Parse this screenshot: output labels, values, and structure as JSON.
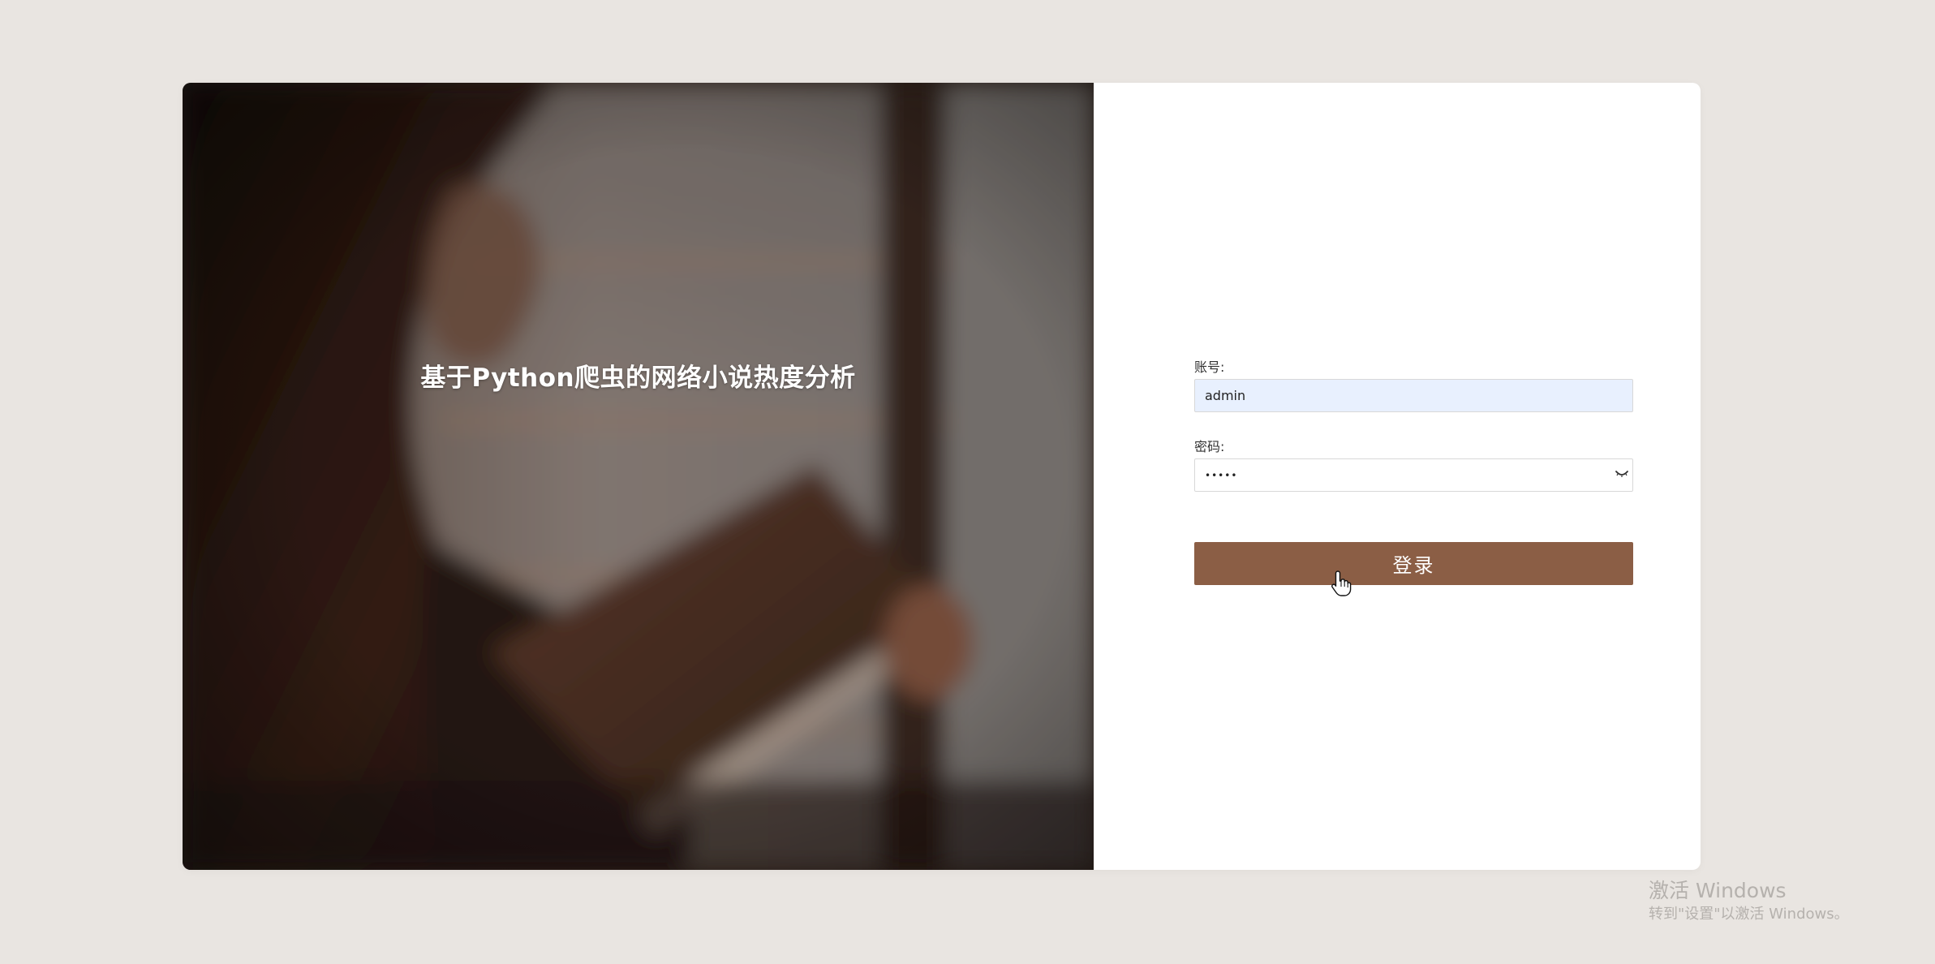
{
  "hero": {
    "title": "基于Python爬虫的网络小说热度分析",
    "image": "woman-reading-book-photo"
  },
  "login_form": {
    "username_label": "账号:",
    "username_value": "admin",
    "password_label": "密码:",
    "password_value": "•••••",
    "password_toggle_icon": "eye-closed-icon",
    "submit_label": "登录"
  },
  "watermark": {
    "title": "激活 Windows",
    "subtitle": "转到\"设置\"以激活 Windows。"
  },
  "colors": {
    "page_background": "#e9e5e1",
    "button": "#8b5e45",
    "username_field": "#e8f0fe"
  }
}
